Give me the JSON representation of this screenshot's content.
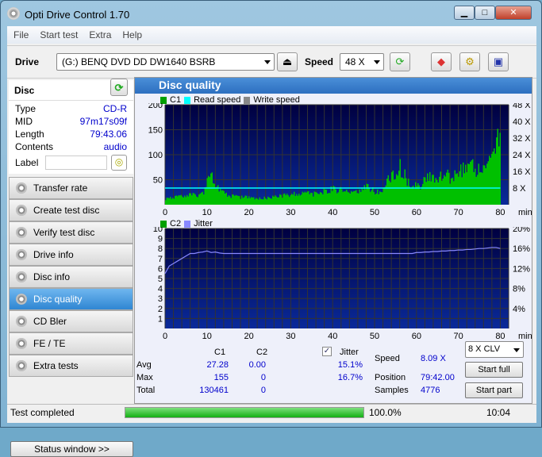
{
  "app": {
    "title": "Opti Drive Control 1.70"
  },
  "menu": [
    "File",
    "Start test",
    "Extra",
    "Help"
  ],
  "toolbar": {
    "drive_label": "Drive",
    "drive_value": "(G:)   BENQ DVD DD DW1640 BSRB",
    "speed_label": "Speed",
    "speed_value": "48 X"
  },
  "disc": {
    "header": "Disc",
    "fields": [
      {
        "k": "Type",
        "v": "CD-R"
      },
      {
        "k": "MID",
        "v": "97m17s09f"
      },
      {
        "k": "Length",
        "v": "79:43.06"
      },
      {
        "k": "Contents",
        "v": "audio"
      }
    ],
    "label_key": "Label",
    "label_value": ""
  },
  "nav": [
    "Transfer rate",
    "Create test disc",
    "Verify test disc",
    "Drive info",
    "Disc info",
    "Disc quality",
    "CD Bler",
    "FE / TE",
    "Extra tests"
  ],
  "nav_active": "Disc quality",
  "status_window": "Status window >>",
  "panel": {
    "title": "Disc quality"
  },
  "chart_data": [
    {
      "type": "bar",
      "legend": [
        "C1",
        "Read speed",
        "Write speed"
      ],
      "xlabel": "min",
      "xlim": [
        0,
        82
      ],
      "ylim": [
        0,
        200
      ],
      "y_ticks": [
        50,
        100,
        150,
        200
      ],
      "y2_ticks": [
        "8 X",
        "16 X",
        "24 X",
        "32 X",
        "40 X",
        "48 X"
      ],
      "y2lim": [
        0,
        48
      ],
      "x_ticks": [
        0,
        10,
        20,
        30,
        40,
        50,
        60,
        70,
        80
      ],
      "grid": true,
      "c1_per_minute": [
        12,
        15,
        14,
        18,
        16,
        15,
        20,
        18,
        20,
        22,
        55,
        55,
        45,
        30,
        22,
        18,
        17,
        16,
        15,
        15,
        14,
        14,
        13,
        13,
        14,
        15,
        16,
        17,
        18,
        20,
        20,
        22,
        22,
        24,
        22,
        20,
        22,
        24,
        26,
        28,
        32,
        30,
        28,
        26,
        25,
        26,
        28,
        30,
        35,
        30,
        26,
        28,
        28,
        50,
        55,
        60,
        75,
        60,
        45,
        40,
        35,
        40,
        50,
        55,
        55,
        55,
        55,
        60,
        55,
        60,
        65,
        70,
        65,
        75,
        70,
        70,
        75,
        80,
        90,
        120,
        130
      ],
      "read_speed_x": 8,
      "colors": {
        "c1": "#00c000",
        "read": "#00ffff",
        "write": "#888888",
        "bg": "#000040"
      }
    },
    {
      "type": "line",
      "legend": [
        "C2",
        "Jitter"
      ],
      "xlabel": "min",
      "xlim": [
        0,
        82
      ],
      "ylim": [
        0,
        10
      ],
      "y_ticks": [
        1,
        2,
        3,
        4,
        5,
        6,
        7,
        8,
        9,
        10
      ],
      "y2_ticks": [
        "4%",
        "8%",
        "12%",
        "16%",
        "20%"
      ],
      "y2lim": [
        0,
        20
      ],
      "x_ticks": [
        0,
        10,
        20,
        30,
        40,
        50,
        60,
        70,
        80
      ],
      "grid": true,
      "jitter_pct": [
        11,
        12.5,
        13,
        13.5,
        14,
        14.5,
        15,
        15,
        15.2,
        15.3,
        15.5,
        15.2,
        15.3,
        15.1,
        15,
        15,
        15,
        15,
        15,
        15,
        15,
        15,
        15,
        15,
        15,
        15,
        15,
        15,
        15,
        15,
        15,
        15,
        15,
        15,
        15,
        15,
        15,
        15,
        15,
        15,
        15,
        15,
        15,
        15,
        15,
        15,
        15,
        15,
        15,
        15,
        15,
        15,
        15,
        15,
        15,
        15,
        15,
        15,
        15,
        15,
        15.2,
        15.2,
        15.3,
        15.3,
        15.4,
        15.4,
        15.5,
        15.5,
        15.6,
        15.6,
        15.7,
        15.7,
        15.8,
        15.8,
        15.9,
        16,
        16,
        16.1,
        16.2,
        16.2,
        16
      ],
      "c2_per_minute": 0,
      "colors": {
        "c2": "#008000",
        "jitter": "#8888ff",
        "bg": "#000040"
      }
    }
  ],
  "stats": {
    "col_c1": "C1",
    "col_c2": "C2",
    "jitter_label": "Jitter",
    "jitter_checked": true,
    "avg_label": "Avg",
    "max_label": "Max",
    "total_label": "Total",
    "avg_c1": "27.28",
    "avg_c2": "0.00",
    "avg_jitter": "15.1%",
    "max_c1": "155",
    "max_c2": "0",
    "max_jitter": "16.7%",
    "total_c1": "130461",
    "total_c2": "0",
    "speed_label": "Speed",
    "speed_value": "8.09 X",
    "position_label": "Position",
    "position_value": "79:42.00",
    "samples_label": "Samples",
    "samples_value": "4776",
    "mode": "8 X CLV",
    "start_full": "Start full",
    "start_part": "Start part"
  },
  "statusbar": {
    "text": "Test completed",
    "progress_pct": 100,
    "progress_text": "100.0%",
    "time": "10:04"
  }
}
